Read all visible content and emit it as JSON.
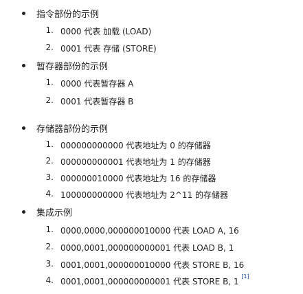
{
  "sections": [
    {
      "heading": "指令部份的示例",
      "items": [
        {
          "num": "1.",
          "text": "0000 代表 加载 (LOAD)"
        },
        {
          "num": "2.",
          "text": "0001 代表 存储 (STORE)"
        }
      ]
    },
    {
      "heading": "暂存器部份的示例",
      "items": [
        {
          "num": "1.",
          "text": "0000 代表暂存器 A"
        },
        {
          "num": "2.",
          "text": "0001 代表暂存器 B"
        }
      ]
    },
    {
      "heading": "存储器部份的示例",
      "items": [
        {
          "num": "1.",
          "text": "000000000000 代表地址为 0 的存储器"
        },
        {
          "num": "2.",
          "text": "000000000001 代表地址为 1 的存储器"
        },
        {
          "num": "3.",
          "text": "000000010000 代表地址为 16 的存储器"
        },
        {
          "num": "4.",
          "text": "100000000000 代表地址为 2^11 的存储器"
        }
      ]
    },
    {
      "heading": "集成示例",
      "items": [
        {
          "num": "1.",
          "text": "0000,0000,000000010000 代表 LOAD A, 16"
        },
        {
          "num": "2.",
          "text": "0000,0001,000000000001 代表 LOAD B, 1"
        },
        {
          "num": "3.",
          "text": "0001,0001,000000010000 代表 STORE B, 16"
        },
        {
          "num": "4.",
          "text": "0001,0001,000000000001 代表 STORE B, 1"
        }
      ],
      "footnote": "[1]"
    }
  ]
}
